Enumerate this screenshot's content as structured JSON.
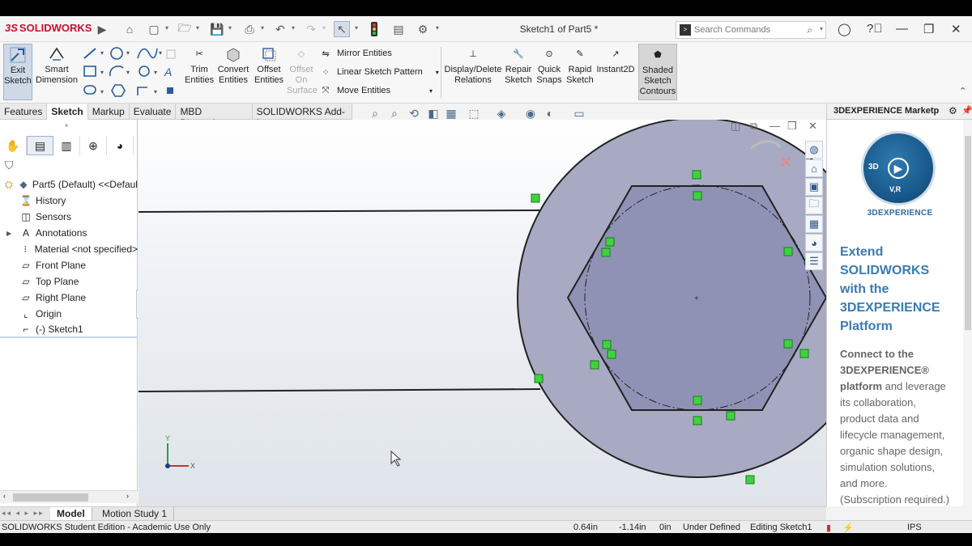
{
  "app": {
    "logo_text": "SOLIDWORKS",
    "logo_prefix": "3S",
    "document_title": "Sketch1 of Part5 *"
  },
  "search": {
    "placeholder": "Search Commands"
  },
  "command_manager": {
    "exit_sketch": "Exit\nSketch",
    "smart_dimension": "Smart\nDimension",
    "trim_entities": "Trim\nEntities",
    "convert_entities": "Convert\nEntities",
    "offset_entities": "Offset\nEntities",
    "offset_on_surface": "Offset\nOn\nSurface",
    "mirror_entities": "Mirror Entities",
    "linear_sketch_pattern": "Linear Sketch Pattern",
    "move_entities": "Move Entities",
    "display_delete_relations": "Display/Delete\nRelations",
    "repair_sketch": "Repair\nSketch",
    "quick_snaps": "Quick\nSnaps",
    "rapid_sketch": "Rapid\nSketch",
    "instant2d": "Instant2D",
    "shaded_sketch_contours": "Shaded\nSketch\nContours"
  },
  "tabs": [
    "Features",
    "Sketch",
    "Markup",
    "Evaluate",
    "MBD Dimensions",
    "SOLIDWORKS Add-Ins"
  ],
  "active_tab": "Sketch",
  "feature_tree": {
    "root": "Part5 (Default) <<Defaul",
    "items": [
      {
        "label": "History",
        "icon": "history-icon"
      },
      {
        "label": "Sensors",
        "icon": "sensors-icon"
      },
      {
        "label": "Annotations",
        "icon": "annotations-icon"
      },
      {
        "label": "Material <not specified>",
        "icon": "material-icon"
      },
      {
        "label": "Front Plane",
        "icon": "plane-icon"
      },
      {
        "label": "Top Plane",
        "icon": "plane-icon"
      },
      {
        "label": "Right Plane",
        "icon": "plane-icon"
      },
      {
        "label": "Origin",
        "icon": "origin-icon"
      },
      {
        "label": "(-) Sketch1",
        "icon": "sketch-icon"
      }
    ]
  },
  "triad": {
    "x_label": "X",
    "y_label": "Y"
  },
  "task_pane": {
    "header": "3DEXPERIENCE Marketp",
    "logo_text": "3DEXPERIENCE",
    "logo_inner": "V,R",
    "logo_3d": "3D",
    "heading_lines": [
      "Extend",
      "SOLIDWORKS",
      "with the",
      "3DEXPERIENCE",
      "Platform"
    ],
    "body_bold_1": "Connect to the",
    "body_bold_2": "3DEXPERIENCE®",
    "body_bold_3": "platform",
    "body_rest_1": " and leverage",
    "body_lines": [
      "its collaboration,",
      "product data and",
      "lifecycle management,",
      "organic shape design,",
      "simulation solutions,",
      "and more.",
      "(Subscription required.)"
    ]
  },
  "bottom_tabs": [
    "Model",
    "Motion Study 1"
  ],
  "active_bottom_tab": "Model",
  "status": {
    "edition": "SOLIDWORKS Student Edition - Academic Use Only",
    "x": "0.64in",
    "y": "-1.14in",
    "z": "0in",
    "state": "Under Defined",
    "editing": "Editing Sketch1",
    "units": "IPS"
  },
  "colors": {
    "brand": "#c8102e",
    "disk_fill": "#a8aac4",
    "hex_fill": "#8f92b4",
    "relation_green": "#3fd23f",
    "heading_blue": "#3b7bb0"
  }
}
